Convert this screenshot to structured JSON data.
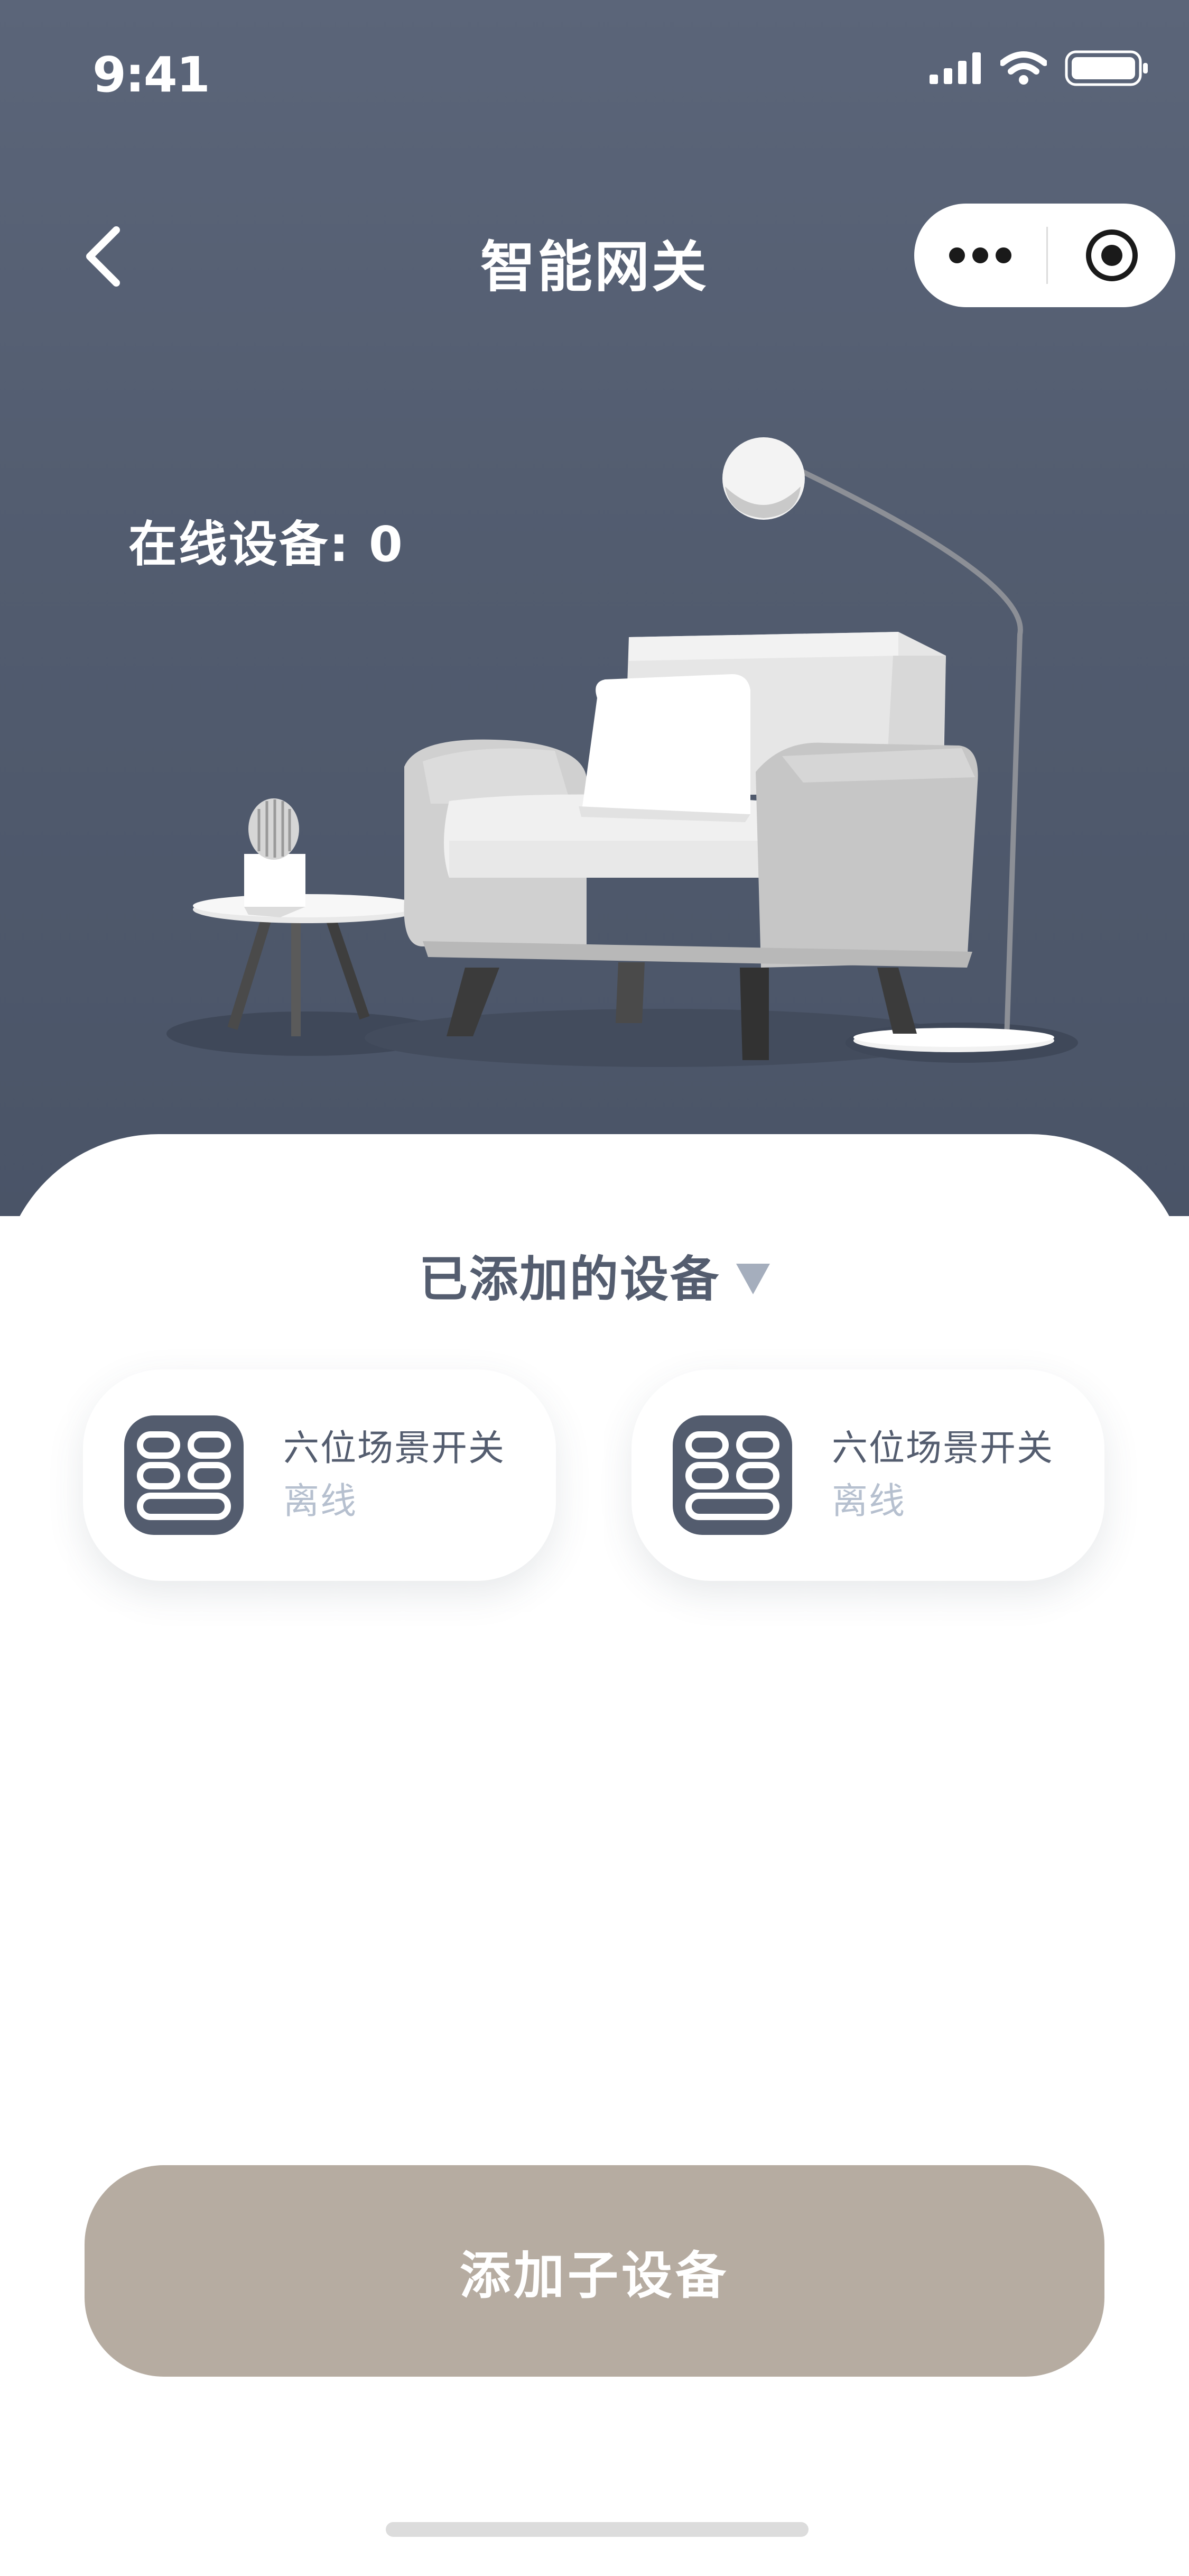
{
  "status_bar": {
    "time": "9:41"
  },
  "nav": {
    "title": "智能网关"
  },
  "hero": {
    "online_label": "在线设备",
    "online_count": "0",
    "online_text": "在线设备: 0"
  },
  "section": {
    "title": "已添加的设备"
  },
  "devices": [
    {
      "name": "六位场景开关",
      "status": "离线"
    },
    {
      "name": "六位场景开关",
      "status": "离线"
    }
  ],
  "actions": {
    "add_sub_device": "添加子设备"
  },
  "colors": {
    "hero_bg": "#525c6f",
    "accent_button": "#b6aca1",
    "device_icon_bg": "#535c6e",
    "offline_text": "#b6c0cf",
    "title_text": "#545d6f"
  },
  "icons": {
    "back": "chevron-left-icon",
    "more": "more-dots-icon",
    "close_target": "target-icon",
    "device": "scene-switch-icon",
    "caret": "triangle-down-icon"
  }
}
